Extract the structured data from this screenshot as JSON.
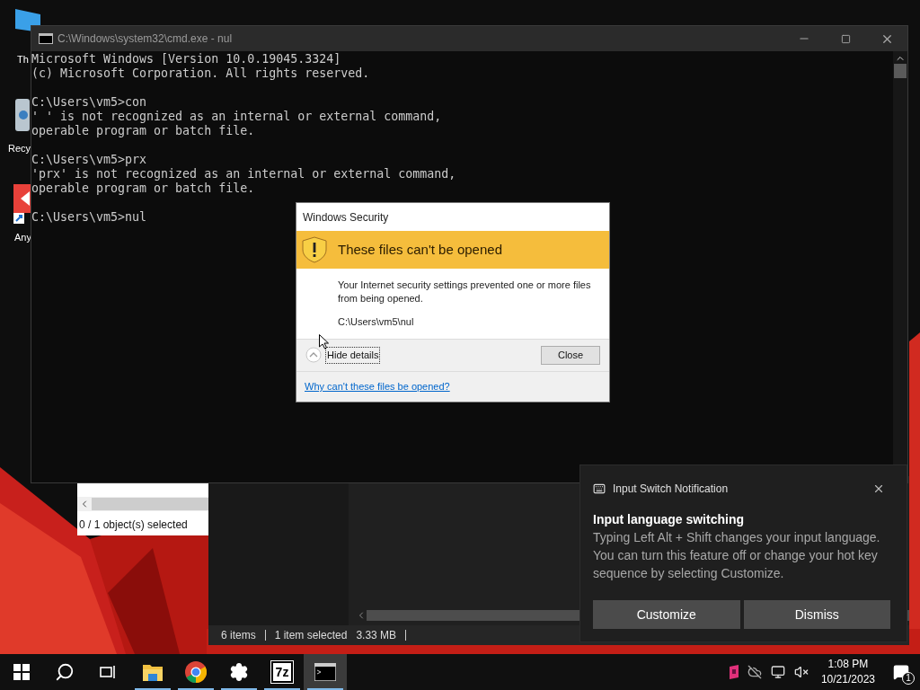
{
  "desktop_icons": [
    {
      "kind": "computer",
      "label": "Th"
    },
    {
      "kind": "recycle",
      "label": "Recy"
    },
    {
      "kind": "app",
      "label": "Any"
    }
  ],
  "archive_window": {
    "status": "0 / 1 object(s) selected"
  },
  "explorer_window": {
    "status_items": [
      "6 items",
      "1 item selected",
      "3.33 MB"
    ]
  },
  "console": {
    "title": "C:\\Windows\\system32\\cmd.exe - nul",
    "blocks": [
      [
        "Microsoft Windows [Version 10.0.19045.3324]",
        "(c) Microsoft Corporation. All rights reserved."
      ],
      [
        "C:\\Users\\vm5>con",
        "' ' is not recognized as an internal or external command,",
        "operable program or batch file."
      ],
      [
        "C:\\Users\\vm5>prx",
        "'prx' is not recognized as an internal or external command,",
        "operable program or batch file."
      ],
      [
        "C:\\Users\\vm5>nul"
      ]
    ]
  },
  "dialog": {
    "title": "Windows Security",
    "heading": "These files can't be opened",
    "message": "Your Internet security settings prevented one or more files from being opened.",
    "path": "C:\\Users\\vm5\\nul",
    "details_toggle": "Hide details",
    "expanded": true,
    "close_button": "Close",
    "link": "Why can't these files be opened?"
  },
  "notification": {
    "app": "Input Switch Notification",
    "title": "Input language switching",
    "body": "Typing Left Alt + Shift changes your input language. You can turn this feature off or change your hot key sequence by selecting Customize.",
    "buttons": [
      "Customize",
      "Dismiss"
    ]
  },
  "taskbar": {
    "buttons": [
      {
        "kind": "start",
        "running": false,
        "selected": false
      },
      {
        "kind": "search",
        "running": false,
        "selected": false
      },
      {
        "kind": "task-view",
        "running": false,
        "selected": false
      },
      {
        "kind": "folder",
        "running": true,
        "selected": false
      },
      {
        "kind": "browser",
        "running": true,
        "selected": false
      },
      {
        "kind": "settings",
        "running": true,
        "selected": false
      },
      {
        "kind": "archiver",
        "label": "7z",
        "running": true,
        "selected": false
      },
      {
        "kind": "console",
        "running": true,
        "selected": true
      }
    ],
    "clock": {
      "time": "1:08 PM",
      "date": "10/21/2023"
    },
    "notification_count": "1"
  }
}
